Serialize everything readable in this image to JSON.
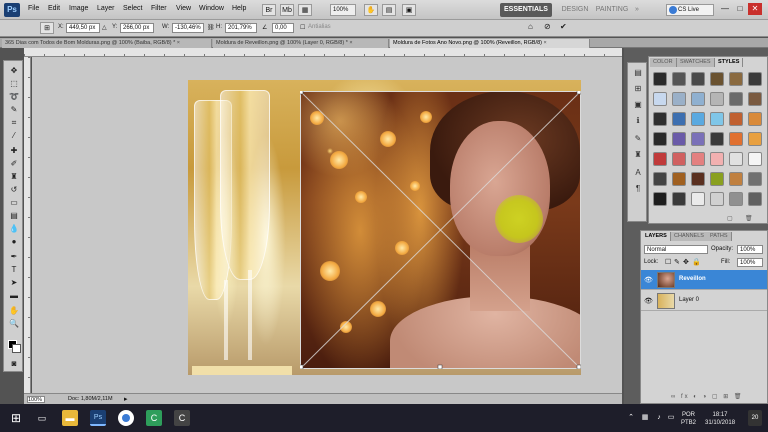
{
  "app": {
    "logo": "Ps",
    "menu": [
      "File",
      "Edit",
      "Image",
      "Layer",
      "Select",
      "Filter",
      "View",
      "Window",
      "Help"
    ],
    "zoom_select": "100%",
    "workspaces": [
      "ESSENTIALS",
      "DESIGN",
      "PAINTING"
    ],
    "more": "»",
    "cs_live": "CS Live",
    "window_controls": [
      "—",
      "□",
      "✕"
    ]
  },
  "options": {
    "x_label": "X:",
    "x_value": "449,50 px",
    "y_label": "Y:",
    "y_value": "266,00 px",
    "w_label": "W:",
    "w_value": "-130,46%",
    "h_label": "H:",
    "h_value": "201,79%",
    "rotate_value": "0,00",
    "h_skew_label": "H:",
    "h_skew_value": "0,00",
    "v_label": "V:",
    "v_value": "0,00",
    "interp_label": "Antialias"
  },
  "tabs": [
    {
      "title": "365 Dias com Todos de Bom Molduras.png @ 100% (Baiba, RGB/8) *",
      "close": "×"
    },
    {
      "title": "Moldura de Reveillon.png @ 100% (Layer 0, RGB/8) *",
      "close": "×"
    },
    {
      "title": "Moldura de Fotos Ano Novo.png @ 100% (Reveillon, RGB/8)",
      "close": "×"
    }
  ],
  "status": {
    "zoom": "100%",
    "doc": "Doc: 1,80M/2,11M"
  },
  "panels": {
    "swatch_tabs": [
      "COLOR",
      "SWATCHES",
      "STYLES"
    ],
    "layers_tabs": [
      "LAYERS",
      "CHANNELS",
      "PATHS"
    ],
    "blend_mode": "Normal",
    "opacity_label": "Opacity:",
    "opacity_value": "100%",
    "lock_label": "Lock:",
    "fill_label": "Fill:",
    "fill_value": "100%",
    "layers": [
      {
        "name": "Reveillon",
        "selected": true
      },
      {
        "name": "Layer 0",
        "selected": false
      }
    ],
    "footer_icons": "∞  fx  ◐  ◑  ▢  ⊞  🗑"
  },
  "taskbar": {
    "start": "⊞",
    "lang": "POR",
    "lang2": "PTB2",
    "time": "18:17",
    "date": "31/10/2018",
    "notify": "20"
  },
  "icons": [
    "move-icon",
    "marquee-icon",
    "lasso-icon",
    "quick-select-icon",
    "crop-icon",
    "eyedropper-icon",
    "spot-heal-icon",
    "brush-icon",
    "clone-stamp-icon",
    "history-brush-icon",
    "eraser-icon",
    "gradient-icon",
    "blur-icon",
    "dodge-icon",
    "pen-icon",
    "type-icon",
    "path-select-icon",
    "shape-icon",
    "hand-icon",
    "zoom-icon"
  ]
}
